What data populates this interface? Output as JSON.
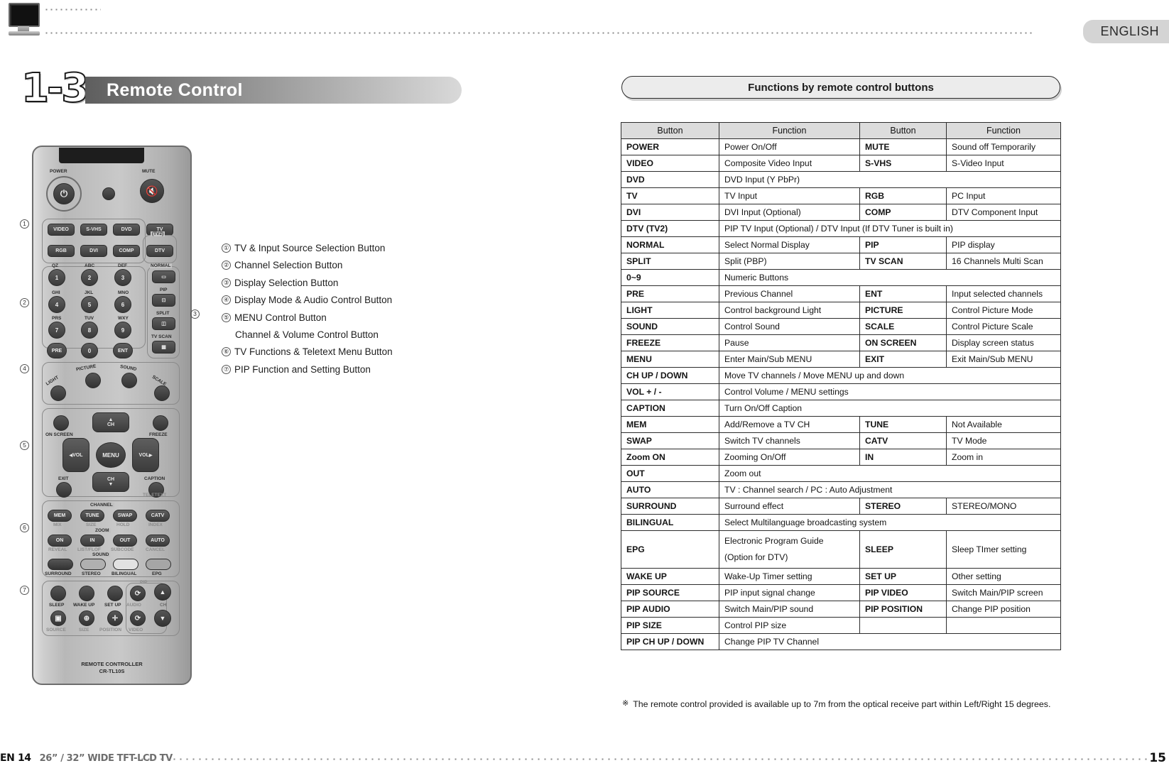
{
  "header": {
    "language_tab": "ENGLISH",
    "tv_icon": "tv-icon"
  },
  "section": {
    "number": "1-3.",
    "title": "Remote Control"
  },
  "remote": {
    "model_line1": "REMOTE CONTROLLER",
    "model_line2": "CR-TL10S",
    "labels": {
      "power": "POWER",
      "mute": "MUTE",
      "source": [
        "VIDEO",
        "S-VHS",
        "DVD",
        "TV",
        "RGB",
        "DVI",
        "COMP",
        "DTV"
      ],
      "tv2": "(TV2)",
      "keypad_letters": [
        "QZ",
        "ABC",
        "DEF",
        "GHI",
        "JKL",
        "MNO",
        "PRS",
        "TUV",
        "WXY"
      ],
      "keypad_digits": [
        "1",
        "2",
        "3",
        "4",
        "5",
        "6",
        "7",
        "8",
        "9"
      ],
      "pre": "PRE",
      "zero": "0",
      "ent": "ENT",
      "normal": "NORMAL",
      "pip": "PIP",
      "split": "SPLIT",
      "tvscan": "TV SCAN",
      "light": "LIGHT",
      "picture": "PICTURE",
      "sound": "SOUND",
      "scale": "SCALE",
      "onscreen": "ON SCREEN",
      "freeze": "FREEZE",
      "ch_up": "CH",
      "ch_down": "CH",
      "vol_left": "VOL",
      "vol_right": "VOL",
      "menu": "MENU",
      "exit": "EXIT",
      "caption": "CAPTION",
      "teletext": "TELETEXT",
      "channel_group": "CHANNEL",
      "mem": "MEM",
      "tune": "TUNE",
      "swap": "SWAP",
      "catv": "CATV",
      "mix": "MIX",
      "size2": "SIZE",
      "hold": "HOLD",
      "index": "INDEX",
      "zoom_group": "ZOOM",
      "on": "ON",
      "in": "IN",
      "out": "OUT",
      "auto": "AUTO",
      "reveal": "REVEAL",
      "listflof": "LIST/FLOF",
      "subcode": "SUBCODE",
      "cancel": "CANCEL",
      "sound_group": "SOUND",
      "surround": "SURROUND",
      "stereo": "STEREO",
      "bilingual": "BILINGUAL",
      "epg": "EPG",
      "sleep": "SLEEP",
      "wakeup": "WAKE UP",
      "setup": "SET UP",
      "audio": "AUDIO",
      "pip_group": "PIP",
      "source_b": "SOURCE",
      "size_b": "SIZE",
      "position_b": "POSITION",
      "video_b": "VIDEO",
      "ch_side": "CH"
    }
  },
  "legend": [
    {
      "num": "①",
      "text": "TV & Input Source Selection Button",
      "indent": false
    },
    {
      "num": "②",
      "text": "Channel Selection Button",
      "indent": false
    },
    {
      "num": "③",
      "text": "Display Selection Button",
      "indent": false
    },
    {
      "num": "④",
      "text": "Display Mode & Audio Control Button",
      "indent": false
    },
    {
      "num": "⑤",
      "text": "MENU Control Button",
      "indent": false
    },
    {
      "num": "",
      "text": "Channel & Volume Control Button",
      "indent": true
    },
    {
      "num": "⑥",
      "text": "TV Functions & Teletext Menu Button",
      "indent": false
    },
    {
      "num": "⑦",
      "text": "PIP Function and Setting Button",
      "indent": false
    }
  ],
  "remote_markers": [
    "1",
    "2",
    "3",
    "4",
    "5",
    "6",
    "7"
  ],
  "panel": {
    "title": "Functions by remote control buttons",
    "headers": [
      "Button",
      "Function",
      "Button",
      "Function"
    ],
    "rows": [
      {
        "b1": "POWER",
        "f1": "Power On/Off",
        "b2": "MUTE",
        "f2": "Sound off Temporarily",
        "span": false
      },
      {
        "b1": "VIDEO",
        "f1": "Composite Video Input",
        "b2": "S-VHS",
        "f2": "S-Video Input",
        "span": false
      },
      {
        "b1": "DVD",
        "f1": "DVD Input (Y PbPr)",
        "b2": "",
        "f2": "",
        "span": true
      },
      {
        "b1": "TV",
        "f1": "TV Input",
        "b2": "RGB",
        "f2": "PC Input",
        "span": false
      },
      {
        "b1": "DVI",
        "f1": "DVI Input (Optional)",
        "b2": "COMP",
        "f2": "DTV Component Input",
        "span": false
      },
      {
        "b1": "DTV (TV2)",
        "f1": "PIP TV Input (Optional) / DTV Input (If DTV Tuner is built in)",
        "b2": "",
        "f2": "",
        "span": true
      },
      {
        "b1": "NORMAL",
        "f1": "Select Normal Display",
        "b2": "PIP",
        "f2": "PIP display",
        "span": false
      },
      {
        "b1": "SPLIT",
        "f1": "Split (PBP)",
        "b2": "TV SCAN",
        "f2": "16 Channels Multi Scan",
        "span": false
      },
      {
        "b1": "0~9",
        "f1": "Numeric Buttons",
        "b2": "",
        "f2": "",
        "span": true
      },
      {
        "b1": "PRE",
        "f1": "Previous Channel",
        "b2": "ENT",
        "f2": "Input selected channels",
        "span": false
      },
      {
        "b1": "LIGHT",
        "f1": "Control background Light",
        "b2": "PICTURE",
        "f2": "Control Picture Mode",
        "span": false
      },
      {
        "b1": "SOUND",
        "f1": "Control Sound",
        "b2": "SCALE",
        "f2": "Control Picture Scale",
        "span": false
      },
      {
        "b1": "FREEZE",
        "f1": "Pause",
        "b2": "ON SCREEN",
        "f2": "Display screen status",
        "span": false
      },
      {
        "b1": "MENU",
        "f1": "Enter Main/Sub MENU",
        "b2": "EXIT",
        "f2": "Exit Main/Sub MENU",
        "span": false
      },
      {
        "b1": "CH UP / DOWN",
        "f1": "Move TV channels / Move MENU up and down",
        "b2": "",
        "f2": "",
        "span": true
      },
      {
        "b1": "VOL + / -",
        "f1": "Control Volume / MENU settings",
        "b2": "",
        "f2": "",
        "span": true
      },
      {
        "b1": "CAPTION",
        "f1": "Turn On/Off Caption",
        "b2": "",
        "f2": "",
        "span": true
      },
      {
        "b1": "MEM",
        "f1": "Add/Remove a TV CH",
        "b2": "TUNE",
        "f2": "Not Available",
        "span": false
      },
      {
        "b1": "SWAP",
        "f1": "Switch TV channels",
        "b2": "CATV",
        "f2": "TV Mode",
        "span": false
      },
      {
        "b1": "Zoom ON",
        "f1": "Zooming On/Off",
        "b2": "IN",
        "f2": "Zoom in",
        "span": false
      },
      {
        "b1": "OUT",
        "f1": "Zoom out",
        "b2": "",
        "f2": "",
        "span": true
      },
      {
        "b1": "AUTO",
        "f1": "TV : Channel search / PC : Auto Adjustment",
        "b2": "",
        "f2": "",
        "span": true
      },
      {
        "b1": "SURROUND",
        "f1": "Surround effect",
        "b2": "STEREO",
        "f2": "STEREO/MONO",
        "span": false
      },
      {
        "b1": "BILINGUAL",
        "f1": "Select Multilanguage broadcasting system",
        "b2": "",
        "f2": "",
        "span": true
      },
      {
        "b1": "EPG",
        "f1": "Electronic Program Guide\n(Option for DTV)",
        "b2": "SLEEP",
        "f2": "Sleep TImer setting",
        "span": false,
        "tall": true
      },
      {
        "b1": "WAKE UP",
        "f1": "Wake-Up Timer setting",
        "b2": "SET UP",
        "f2": "Other setting",
        "span": false
      },
      {
        "b1": "PIP SOURCE",
        "f1": "PIP input signal change",
        "b2": "PIP VIDEO",
        "f2": "Switch Main/PIP screen",
        "span": false
      },
      {
        "b1": "PIP AUDIO",
        "f1": "Switch Main/PIP sound",
        "b2": "PIP POSITION",
        "f2": "Change PIP position",
        "span": false
      },
      {
        "b1": "PIP SIZE",
        "f1": "Control PIP size",
        "b2": "",
        "f2": "",
        "span": false
      },
      {
        "b1": "PIP CH UP / DOWN",
        "f1": "Change PIP TV Channel",
        "b2": "",
        "f2": "",
        "span": true,
        "wide": true
      }
    ],
    "note_mark": "※",
    "note": "The remote control provided is available up to 7m from the optical receive part within Left/Right 15 degrees."
  },
  "footer": {
    "page_label": "EN 14",
    "model": "26” / 32” WIDE TFT-LCD TV",
    "page_number": "15"
  }
}
